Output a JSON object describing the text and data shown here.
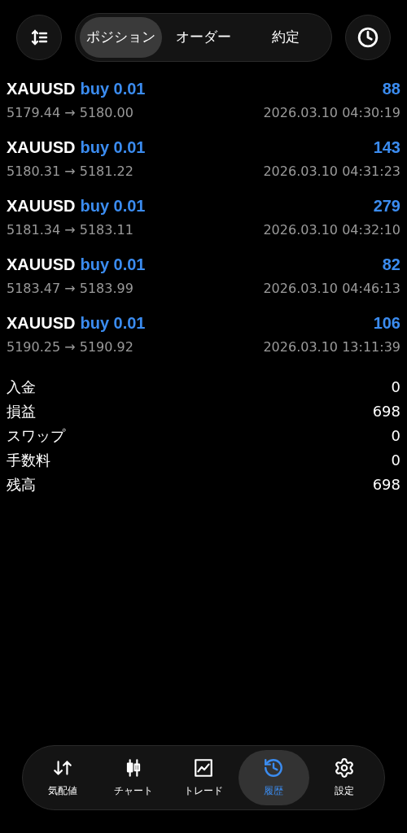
{
  "tabs": [
    {
      "label": "ポジション",
      "selected": true
    },
    {
      "label": "オーダー",
      "selected": false
    },
    {
      "label": "約定",
      "selected": false
    }
  ],
  "trades": [
    {
      "symbol": "XAUUSD",
      "order": "buy 0.01",
      "profit": "88",
      "prices": "5179.44 → 5180.00",
      "time": "2026.03.10 04:30:19"
    },
    {
      "symbol": "XAUUSD",
      "order": "buy 0.01",
      "profit": "143",
      "prices": "5180.31 → 5181.22",
      "time": "2026.03.10 04:31:23"
    },
    {
      "symbol": "XAUUSD",
      "order": "buy 0.01",
      "profit": "279",
      "prices": "5181.34 → 5183.11",
      "time": "2026.03.10 04:32:10"
    },
    {
      "symbol": "XAUUSD",
      "order": "buy 0.01",
      "profit": "82",
      "prices": "5183.47 → 5183.99",
      "time": "2026.03.10 04:46:13"
    },
    {
      "symbol": "XAUUSD",
      "order": "buy 0.01",
      "profit": "106",
      "prices": "5190.25 → 5190.92",
      "time": "2026.03.10 13:11:39"
    }
  ],
  "summary": [
    {
      "label": "入金",
      "value": "0"
    },
    {
      "label": "損益",
      "value": "698"
    },
    {
      "label": "スワップ",
      "value": "0"
    },
    {
      "label": "手数料",
      "value": "0"
    },
    {
      "label": "残高",
      "value": "698"
    }
  ],
  "nav": [
    {
      "label": "気配値",
      "kind": "quotes",
      "selected": false
    },
    {
      "label": "チャート",
      "kind": "chart",
      "selected": false
    },
    {
      "label": "トレード",
      "kind": "trade",
      "selected": false
    },
    {
      "label": "履歴",
      "kind": "history",
      "selected": true
    },
    {
      "label": "設定",
      "kind": "settings",
      "selected": false
    }
  ]
}
